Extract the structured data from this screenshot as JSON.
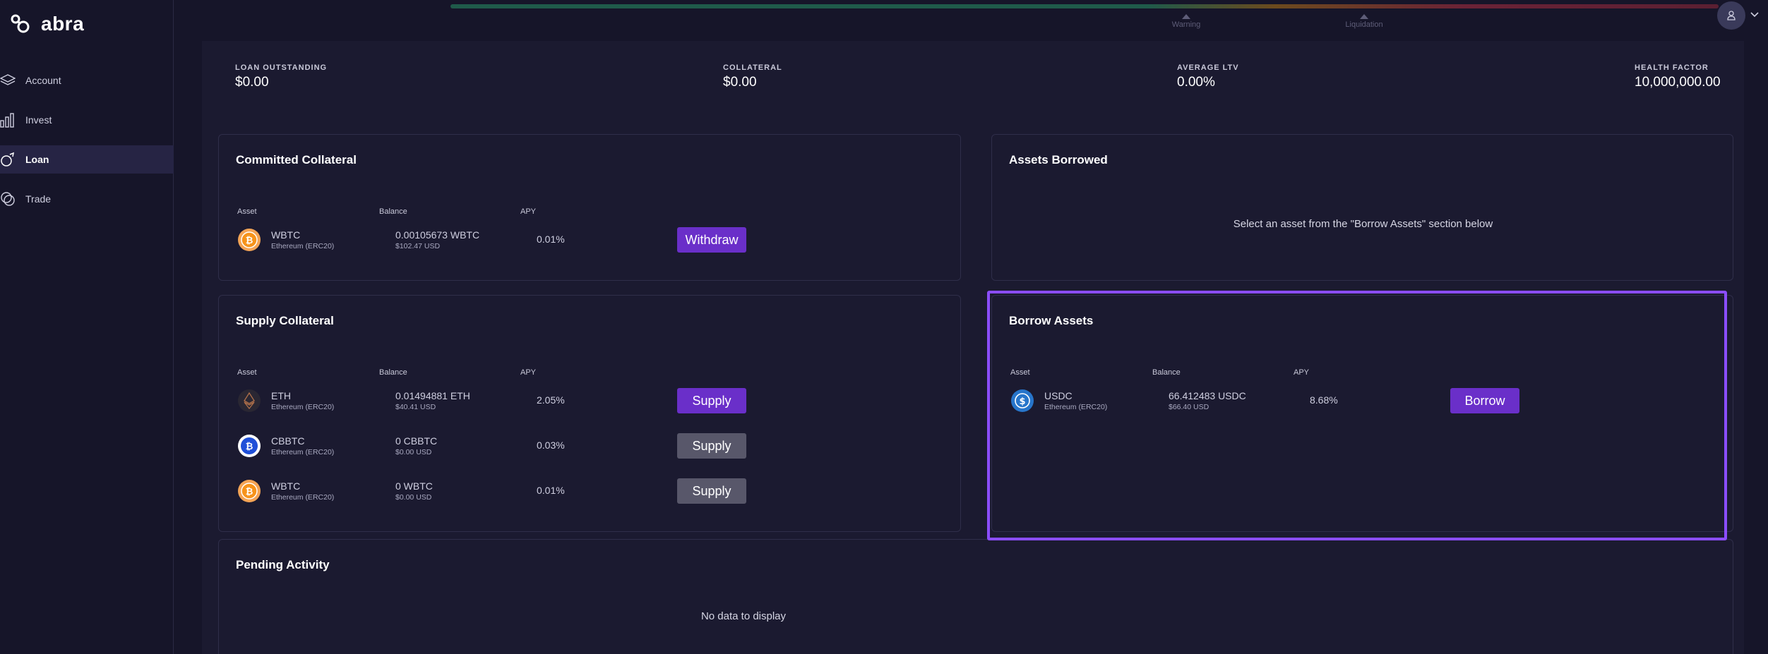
{
  "app": {
    "name": "abra"
  },
  "nav": {
    "items": [
      {
        "label": "Account",
        "icon": "layers-icon"
      },
      {
        "label": "Invest",
        "icon": "bar-chart-icon"
      },
      {
        "label": "Loan",
        "icon": "loan-icon"
      },
      {
        "label": "Trade",
        "icon": "coins-icon"
      }
    ],
    "active": "Loan"
  },
  "health_bar": {
    "markers": [
      "Warning",
      "Liquidation"
    ]
  },
  "stats": {
    "loan_outstanding": {
      "label": "LOAN OUTSTANDING",
      "value": "$0.00"
    },
    "collateral": {
      "label": "COLLATERAL",
      "value": "$0.00"
    },
    "average_ltv": {
      "label": "AVERAGE LTV",
      "value": "0.00%"
    },
    "health_factor": {
      "label": "HEALTH FACTOR",
      "value": "10,000,000.00"
    }
  },
  "columns": {
    "asset": "Asset",
    "balance": "Balance",
    "apy": "APY"
  },
  "committed_collateral": {
    "title": "Committed Collateral",
    "rows": [
      {
        "asset": "WBTC",
        "network": "Ethereum (ERC20)",
        "balance": "0.00105673 WBTC",
        "balance_usd": "$102.47 USD",
        "apy": "0.01%",
        "action": "Withdraw"
      }
    ]
  },
  "assets_borrowed": {
    "title": "Assets Borrowed",
    "empty_message": "Select an asset from the \"Borrow Assets\" section below"
  },
  "supply_collateral": {
    "title": "Supply Collateral",
    "rows": [
      {
        "asset": "ETH",
        "network": "Ethereum (ERC20)",
        "balance": "0.01494881 ETH",
        "balance_usd": "$40.41 USD",
        "apy": "2.05%",
        "action": "Supply",
        "enabled": true
      },
      {
        "asset": "CBBTC",
        "network": "Ethereum (ERC20)",
        "balance": "0 CBBTC",
        "balance_usd": "$0.00 USD",
        "apy": "0.03%",
        "action": "Supply",
        "enabled": false
      },
      {
        "asset": "WBTC",
        "network": "Ethereum (ERC20)",
        "balance": "0 WBTC",
        "balance_usd": "$0.00 USD",
        "apy": "0.01%",
        "action": "Supply",
        "enabled": false
      }
    ]
  },
  "borrow_assets": {
    "title": "Borrow Assets",
    "rows": [
      {
        "asset": "USDC",
        "network": "Ethereum (ERC20)",
        "balance": "66.412483 USDC",
        "balance_usd": "$66.40 USD",
        "apy": "8.68%",
        "action": "Borrow"
      }
    ]
  },
  "pending_activity": {
    "title": "Pending Activity",
    "empty_message": "No data to display"
  },
  "colors": {
    "accent": "#6a2fc9",
    "highlight": "#8b4dff",
    "background": "#161529",
    "panel": "#1b1a30"
  }
}
